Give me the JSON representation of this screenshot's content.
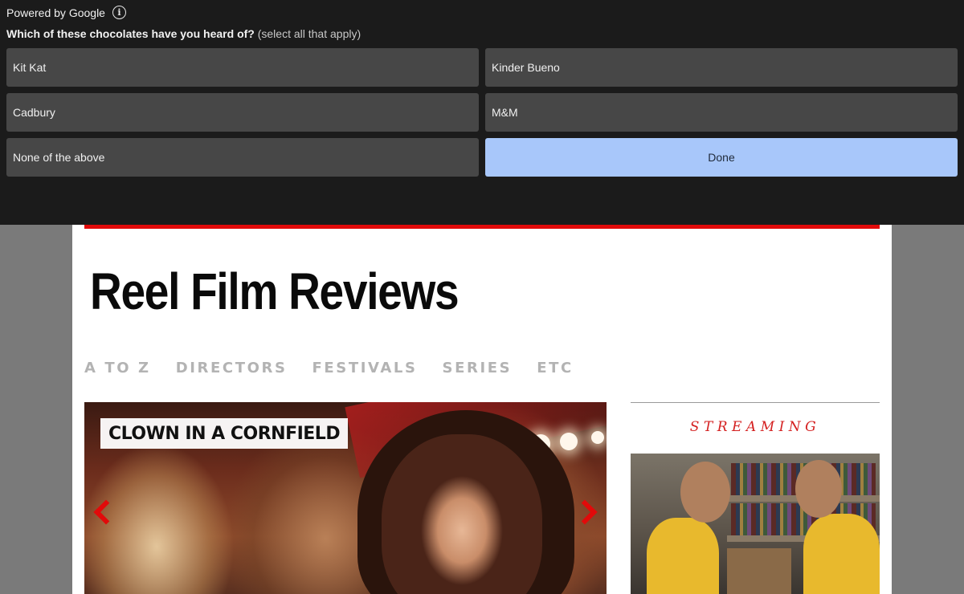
{
  "survey": {
    "powered_by": "Powered by Google",
    "info_icon": "info-circle-icon",
    "question": "Which of these chocolates have you heard of?",
    "question_hint": "(select all that apply)",
    "options": [
      {
        "label": "Kit Kat"
      },
      {
        "label": "Kinder Bueno"
      },
      {
        "label": "Cadbury"
      },
      {
        "label": "M&M"
      },
      {
        "label": "None of the above"
      }
    ],
    "done_label": "Done",
    "colors": {
      "background": "#1b1b1b",
      "option": "#474747",
      "done": "#a8c7fa"
    }
  },
  "site": {
    "title": "Reel Film Reviews",
    "accent": "#e10a0a",
    "nav": [
      "A TO Z",
      "DIRECTORS",
      "FESTIVALS",
      "SERIES",
      "ETC"
    ]
  },
  "hero": {
    "caption": "CLOWN IN A CORNFIELD",
    "prev_icon": "chevron-left-icon",
    "next_icon": "chevron-right-icon"
  },
  "sidebar": {
    "heading": "STREAMING"
  }
}
